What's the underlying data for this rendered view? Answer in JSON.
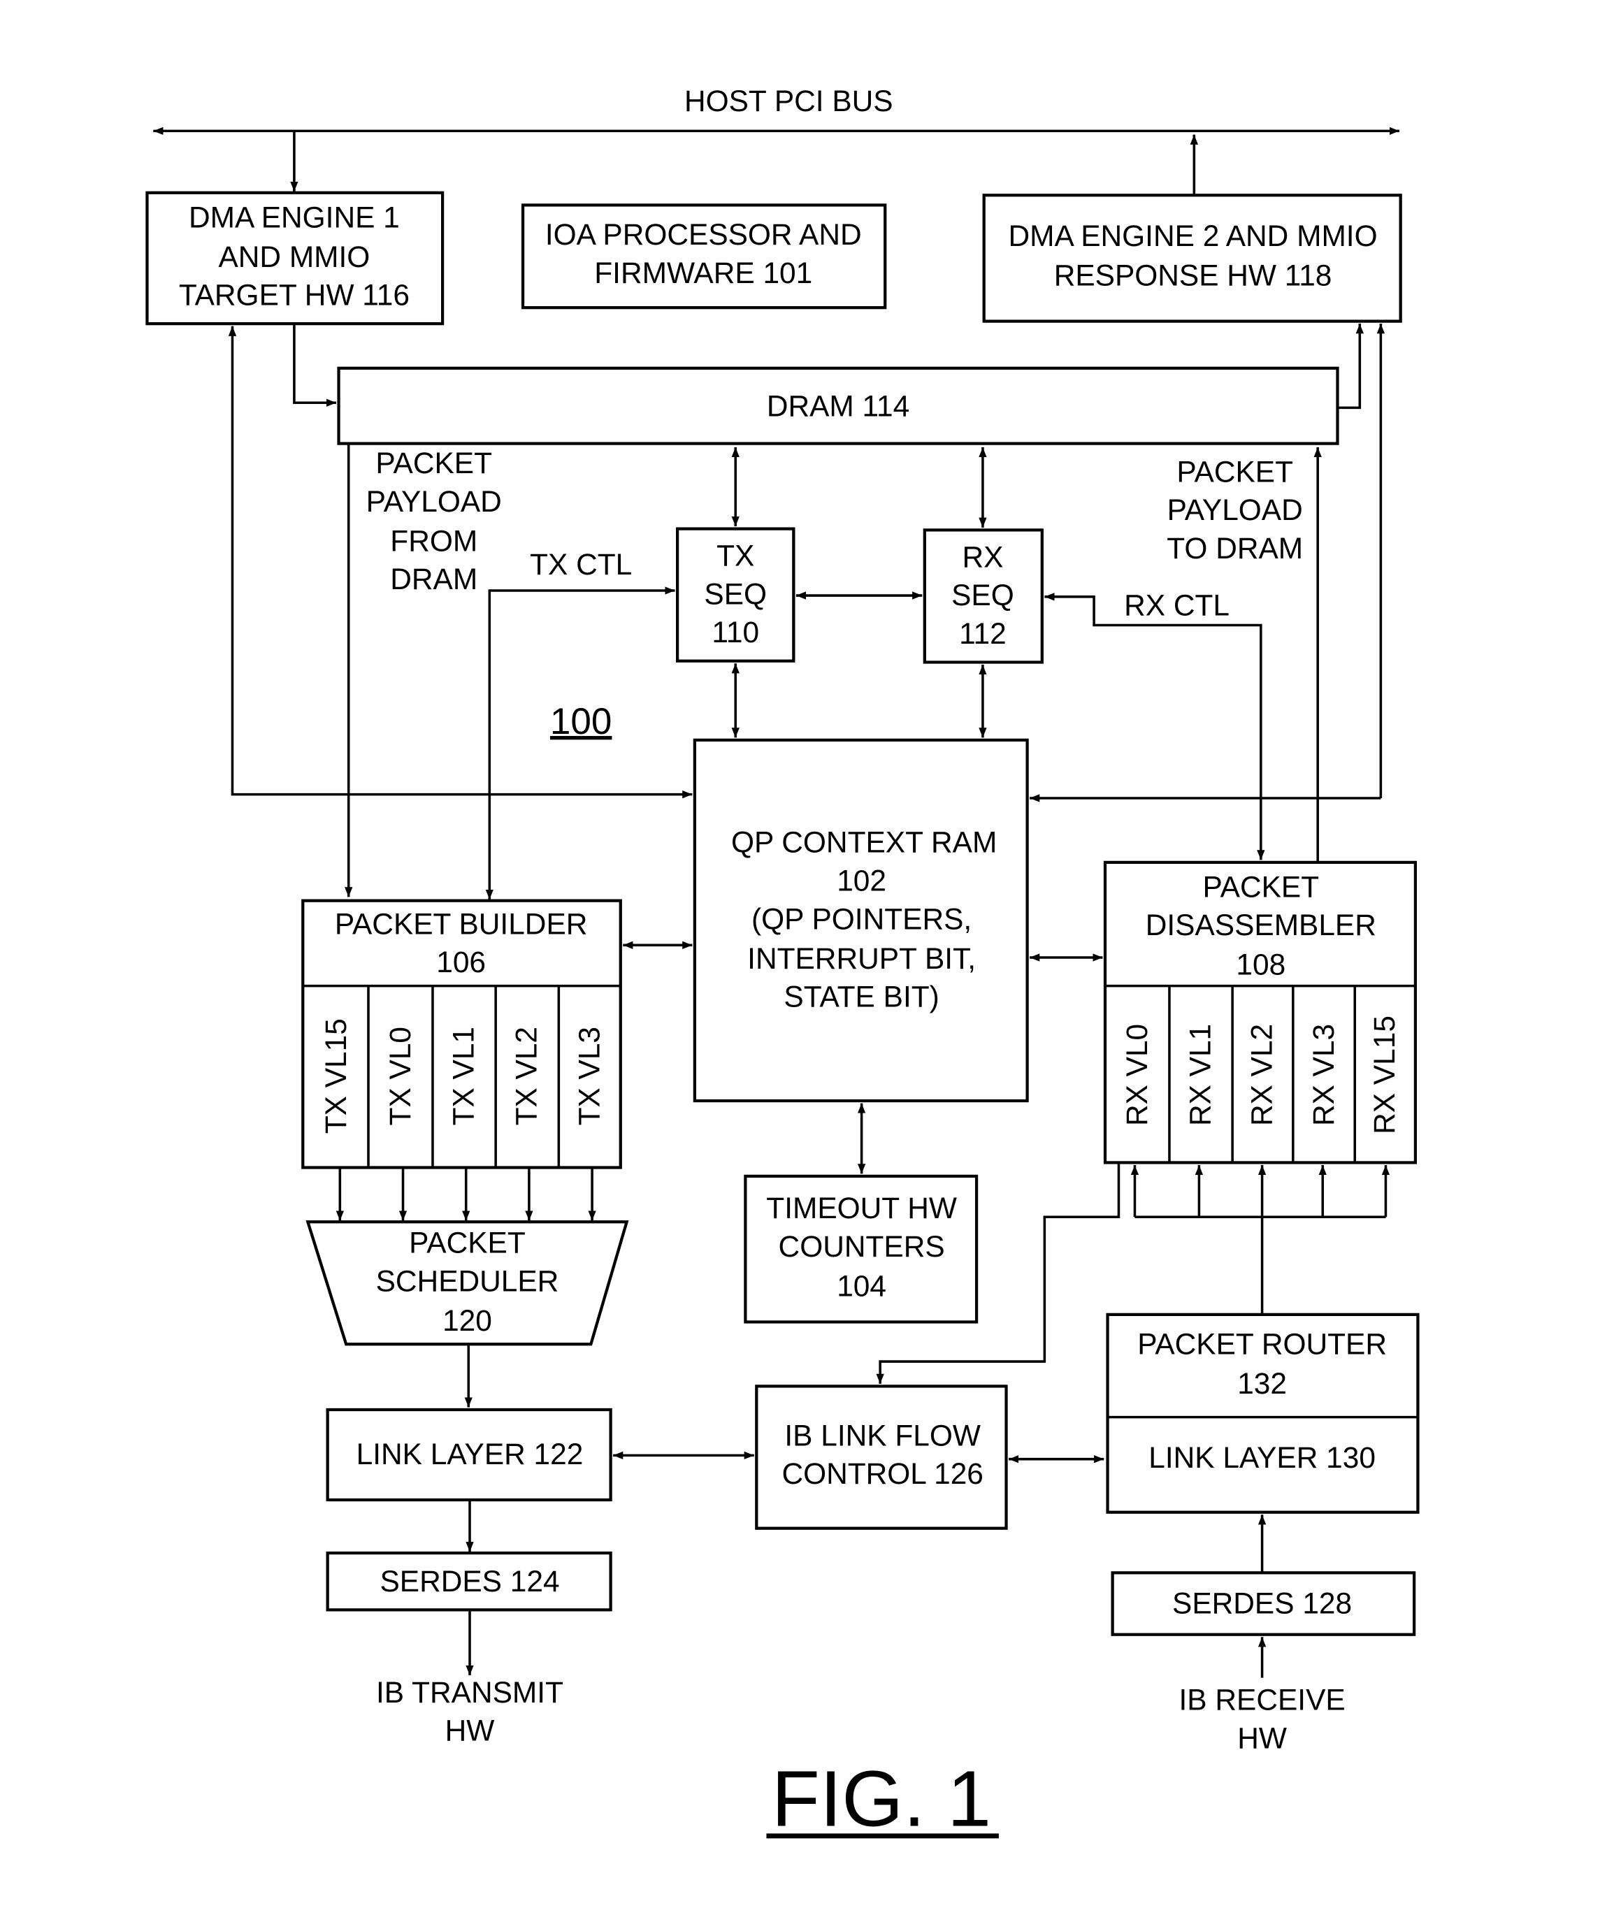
{
  "figure": {
    "caption": "FIG. 1",
    "reference_number": "100",
    "bus_label": "HOST PCI BUS"
  },
  "blocks": {
    "dma1": [
      "DMA ENGINE 1",
      "AND MMIO",
      "TARGET HW 116"
    ],
    "ioa": [
      "IOA PROCESSOR AND",
      "FIRMWARE 101"
    ],
    "dma2": [
      "DMA ENGINE 2 AND MMIO",
      "RESPONSE HW 118"
    ],
    "dram": [
      "DRAM 114"
    ],
    "txseq": [
      "TX",
      "SEQ",
      "110"
    ],
    "rxseq": [
      "RX",
      "SEQ",
      "112"
    ],
    "qp": [
      "QP CONTEXT RAM",
      "102",
      "(QP POINTERS,",
      "INTERRUPT BIT,",
      "STATE BIT)"
    ],
    "builder": [
      "PACKET BUILDER",
      "106"
    ],
    "disassembler": [
      "PACKET",
      "DISASSEMBLER",
      "108"
    ],
    "timeout": [
      "TIMEOUT HW",
      "COUNTERS",
      "104"
    ],
    "scheduler": [
      "PACKET",
      "SCHEDULER",
      "120"
    ],
    "linklayer122": [
      "LINK LAYER 122"
    ],
    "flowctl": [
      "IB LINK FLOW",
      "CONTROL 126"
    ],
    "router": [
      "PACKET ROUTER",
      "132"
    ],
    "linklayer130": [
      "LINK LAYER 130"
    ],
    "serdes124": [
      "SERDES 124"
    ],
    "serdes128": [
      "SERDES 128"
    ]
  },
  "tx_lanes": [
    "TX VL15",
    "TX VL0",
    "TX VL1",
    "TX VL2",
    "TX VL3"
  ],
  "rx_lanes": [
    "RX VL0",
    "RX VL1",
    "RX VL2",
    "RX VL3",
    "RX VL15"
  ],
  "signals": {
    "payload_from": [
      "PACKET",
      "PAYLOAD",
      "FROM",
      "DRAM"
    ],
    "payload_to": [
      "PACKET",
      "PAYLOAD",
      "TO DRAM"
    ],
    "tx_ctl": "TX CTL",
    "rx_ctl": "RX CTL",
    "ib_transmit": [
      "IB TRANSMIT",
      "HW"
    ],
    "ib_receive": [
      "IB RECEIVE",
      "HW"
    ]
  }
}
